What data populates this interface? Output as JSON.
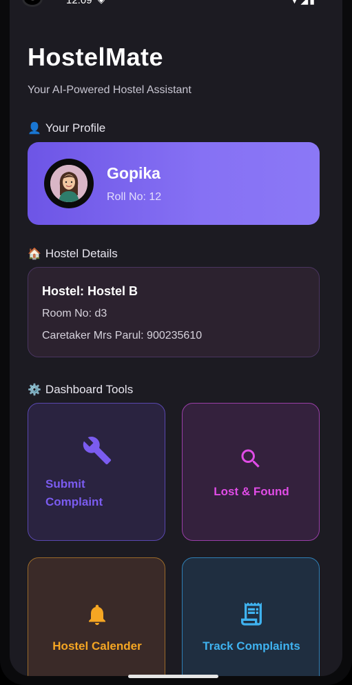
{
  "status_bar": {
    "time": "12:09"
  },
  "app": {
    "title": "HostelMate",
    "subtitle": "Your AI-Powered Hostel Assistant"
  },
  "profile_section": {
    "emoji": "👤",
    "label": "Your Profile",
    "name": "Gopika",
    "roll": "Roll No: 12"
  },
  "hostel_section": {
    "emoji": "🏠",
    "label": "Hostel Details",
    "hostel": "Hostel: Hostel B",
    "room": "Room No: d3",
    "caretaker": "Caretaker Mrs Parul: 900235610"
  },
  "tools_section": {
    "emoji": "⚙️",
    "label": "Dashboard Tools",
    "tools": [
      {
        "label": "Submit Complaint",
        "icon": "wrench-icon",
        "color": "#7b5cf0"
      },
      {
        "label": "Lost & Found",
        "icon": "search-icon",
        "color": "#e04ce6"
      },
      {
        "label": "Hostel Calender",
        "icon": "bell-icon",
        "color": "#f5a623"
      },
      {
        "label": "Track Complaints",
        "icon": "receipt-icon",
        "color": "#3fb2ef"
      }
    ]
  },
  "colors": {
    "background": "#1c1b22",
    "profile_gradient_start": "#6d55e6",
    "profile_gradient_end": "#8b78f6"
  }
}
